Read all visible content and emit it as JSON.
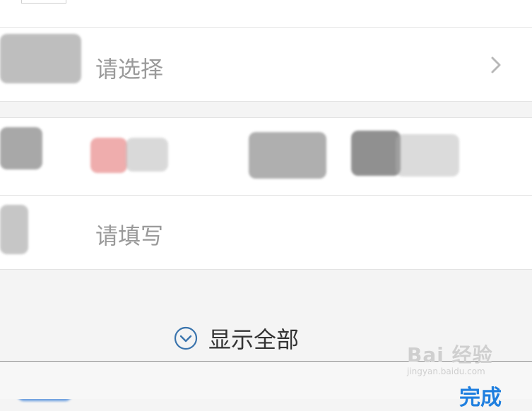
{
  "select_row": {
    "placeholder": "请选择"
  },
  "fill_row": {
    "placeholder": "请填写"
  },
  "show_all": {
    "label": "显示全部"
  },
  "footer": {
    "done_label": "完成"
  },
  "watermark": {
    "main": "Bai 经验",
    "sub": "jingyan.baidu.com"
  },
  "icons": {
    "chevron": "chevron-right-icon",
    "expand": "chevron-down-circle-icon"
  },
  "colors": {
    "accent": "#1f7fdf",
    "placeholder": "#9a9a9a",
    "label": "#333333",
    "background": "#f4f4f4"
  }
}
